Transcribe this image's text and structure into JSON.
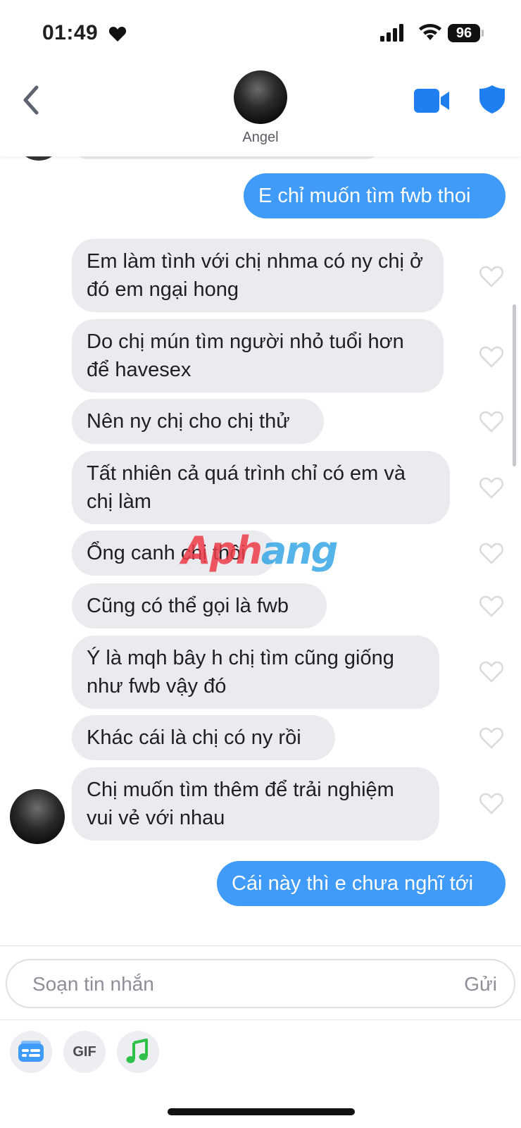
{
  "status_bar": {
    "time": "01:49",
    "battery": "96"
  },
  "header": {
    "contact_name": "Angel"
  },
  "messages": [
    {
      "side": "sent",
      "text": "E chỉ muốn tìm fwb thoi"
    },
    {
      "side": "received",
      "text": "Em làm tình với chị nhma có ny chị ở đó em ngại hong"
    },
    {
      "side": "received",
      "text": "Do chị mún tìm người nhỏ tuổi hơn để havesex"
    },
    {
      "side": "received",
      "text": "Nên ny chị cho chị thử"
    },
    {
      "side": "received",
      "text": "Tất nhiên cả quá trình chỉ có em và chị làm"
    },
    {
      "side": "received",
      "text": "Ổng canh chị thôi"
    },
    {
      "side": "received",
      "text": "Cũng có thể gọi là fwb"
    },
    {
      "side": "received",
      "text": "Ý là mqh bây h chị tìm cũng giống như fwb vậy đó"
    },
    {
      "side": "received",
      "text": "Khác cái là chị có ny rồi"
    },
    {
      "side": "received",
      "text": "Chị muốn tìm thêm để trải nghiệm vui vẻ với nhau"
    },
    {
      "side": "sent",
      "text": "Cái này thì e chưa nghĩ tới"
    }
  ],
  "watermark": {
    "part1": "Aph",
    "part2": "ang"
  },
  "composer": {
    "placeholder": "Soạn tin nhắn",
    "send_label": "Gửi",
    "tools": [
      {
        "name": "card-icon",
        "label": ""
      },
      {
        "name": "gif-button",
        "label": "GIF"
      },
      {
        "name": "music-icon",
        "label": ""
      }
    ]
  },
  "colors": {
    "sent_bubble": "#3f9bf7",
    "received_bubble": "#ebebef",
    "accent": "#1f7ef0",
    "music": "#2fc04a"
  },
  "icons": [
    "heart-icon",
    "signal-icon",
    "wifi-icon",
    "battery-icon",
    "back-chevron-icon",
    "video-call-icon",
    "shield-icon",
    "like-heart-icon",
    "card-icon",
    "music-icon"
  ]
}
